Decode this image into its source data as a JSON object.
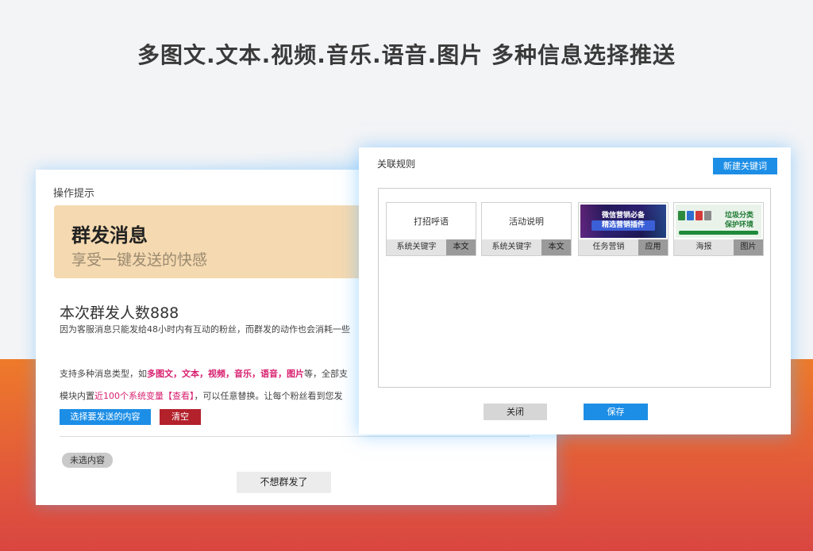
{
  "headline": "多图文.文本.视频.音乐.语音.图片  多种信息选择推送",
  "left_panel": {
    "title": "操作提示",
    "banner_title": "群发消息",
    "banner_subtitle": "享受一键发送的快感",
    "count_text": "本次群发人数888",
    "desc_text": "因为客服消息只能发给48小时内有互动的粉丝，而群发的动作也会消耗一些",
    "types_prefix": "支持多种消息类型，如",
    "types_highlight": "多图文，文本，视频，音乐，语音，图片",
    "types_suffix": "等，全部支",
    "vars_prefix": "模块内置",
    "vars_highlight": "近100个系统变量",
    "vars_link": "【查看】",
    "vars_suffix": "，可以任意替换。让每个粉丝看到您发",
    "select_button": "选择要发送的内容",
    "clear_button": "清空",
    "empty_tag": "未选内容",
    "nosend_button": "不想群发了"
  },
  "right_panel": {
    "title": "关联规则",
    "new_keyword_button": "新建关键词",
    "cards": [
      {
        "body": "打招呼语",
        "key": "系统关键字",
        "type": "本文"
      },
      {
        "body": "活动说明",
        "key": "系统关键字",
        "type": "本文"
      },
      {
        "img_line1": "微信营销必备",
        "img_line2": "精选营销插件",
        "key": "任务营销",
        "type": "应用"
      },
      {
        "img_line1": "垃圾分类",
        "img_line2": "保护环境",
        "key": "海报",
        "type": "图片"
      }
    ],
    "close_button": "关闭",
    "save_button": "保存"
  },
  "colors": {
    "accent_blue": "#1d8ee6",
    "danger_red": "#b3212b",
    "highlight_pink": "#d81f6f",
    "banner_bg": "#f5d9b0"
  }
}
